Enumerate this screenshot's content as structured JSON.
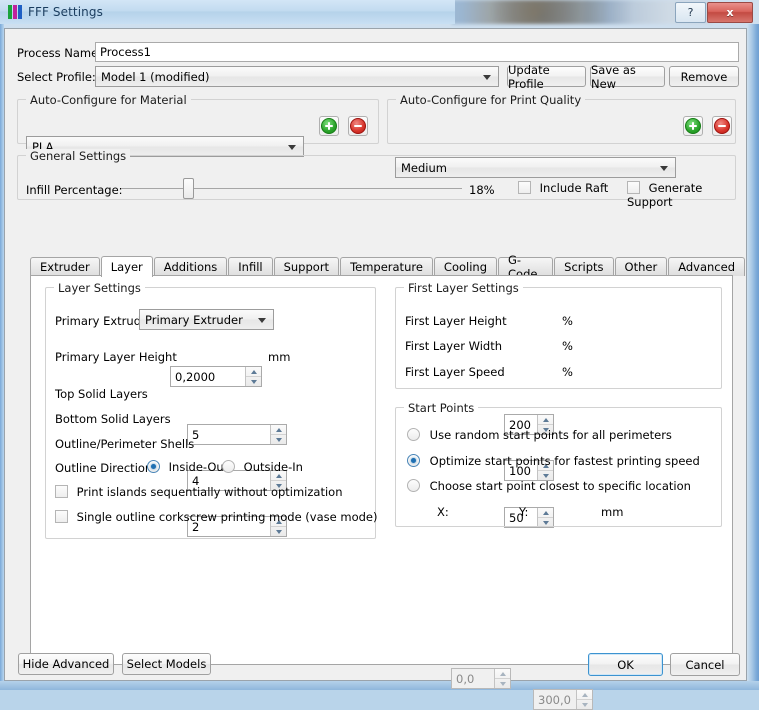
{
  "window": {
    "title": "FFF Settings",
    "icon": "fff-logo-icon",
    "help_label": "?",
    "close_label": "x"
  },
  "header": {
    "process_name_label": "Process Name:",
    "process_name_value": "Process1",
    "process_name_placeholder": "",
    "select_profile_label": "Select Profile:",
    "select_profile_value": "Model 1 (modified)",
    "update_profile_label": "Update Profile",
    "save_as_new_label": "Save as New",
    "remove_label": "Remove"
  },
  "material_group": {
    "title": "Auto-Configure for Material",
    "value": "PLA",
    "add_label": "+",
    "remove_label": "-"
  },
  "quality_group": {
    "title": "Auto-Configure for Print Quality",
    "value": "Medium",
    "add_label": "+",
    "remove_label": "-"
  },
  "general_group": {
    "title": "General Settings",
    "infill_label": "Infill Percentage:",
    "infill_value": "18%",
    "infill_percent": 18,
    "include_raft_label": "Include Raft",
    "include_raft_checked": false,
    "generate_support_label": "Generate Support",
    "generate_support_checked": false
  },
  "tabs": {
    "active": "Layer",
    "items": [
      {
        "label": "Extruder"
      },
      {
        "label": "Layer"
      },
      {
        "label": "Additions"
      },
      {
        "label": "Infill"
      },
      {
        "label": "Support"
      },
      {
        "label": "Temperature"
      },
      {
        "label": "Cooling"
      },
      {
        "label": "G-Code"
      },
      {
        "label": "Scripts"
      },
      {
        "label": "Other"
      },
      {
        "label": "Advanced"
      }
    ]
  },
  "layer_settings": {
    "title": "Layer Settings",
    "primary_extruder_label": "Primary Extruder",
    "primary_extruder_value": "Primary Extruder",
    "primary_layer_height_label": "Primary Layer Height",
    "primary_layer_height_value": "0,2000",
    "primary_layer_height_unit": "mm",
    "top_solid_layers_label": "Top Solid Layers",
    "top_solid_layers_value": "5",
    "bottom_solid_layers_label": "Bottom Solid Layers",
    "bottom_solid_layers_value": "4",
    "outline_shells_label": "Outline/Perimeter Shells",
    "outline_shells_value": "2",
    "outline_direction_label": "Outline Direction:",
    "inside_out_label": "Inside-Out",
    "outside_in_label": "Outside-In",
    "outline_direction_selected": "Inside-Out",
    "print_islands_label": "Print islands sequentially without optimization",
    "print_islands_checked": false,
    "vase_mode_label": "Single outline corkscrew printing mode (vase mode)",
    "vase_mode_checked": false
  },
  "first_layer_settings": {
    "title": "First Layer Settings",
    "height_label": "First Layer Height",
    "height_value": "200",
    "height_unit": "%",
    "width_label": "First Layer Width",
    "width_value": "100",
    "width_unit": "%",
    "speed_label": "First Layer Speed",
    "speed_value": "50",
    "speed_unit": "%"
  },
  "start_points": {
    "title": "Start Points",
    "random_label": "Use random start points for all perimeters",
    "optimize_label": "Optimize start points for fastest printing speed",
    "closest_label": "Choose start point closest to specific location",
    "selected": "Optimize start points for fastest printing speed",
    "x_label": "X:",
    "x_value": "0,0",
    "y_label": "Y:",
    "y_value": "300,0",
    "unit": "mm"
  },
  "footer": {
    "hide_advanced_label": "Hide Advanced",
    "select_models_label": "Select Models",
    "ok_label": "OK",
    "cancel_label": "Cancel"
  },
  "colors": {
    "accent": "#1f6fb2",
    "title_text": "#1a3c5e",
    "close_button": "#c34a42",
    "add_button": "#29a329",
    "remove_button": "#d8332a",
    "dialog_bg": "#f0f0f0",
    "panel_bg": "#ffffff"
  }
}
